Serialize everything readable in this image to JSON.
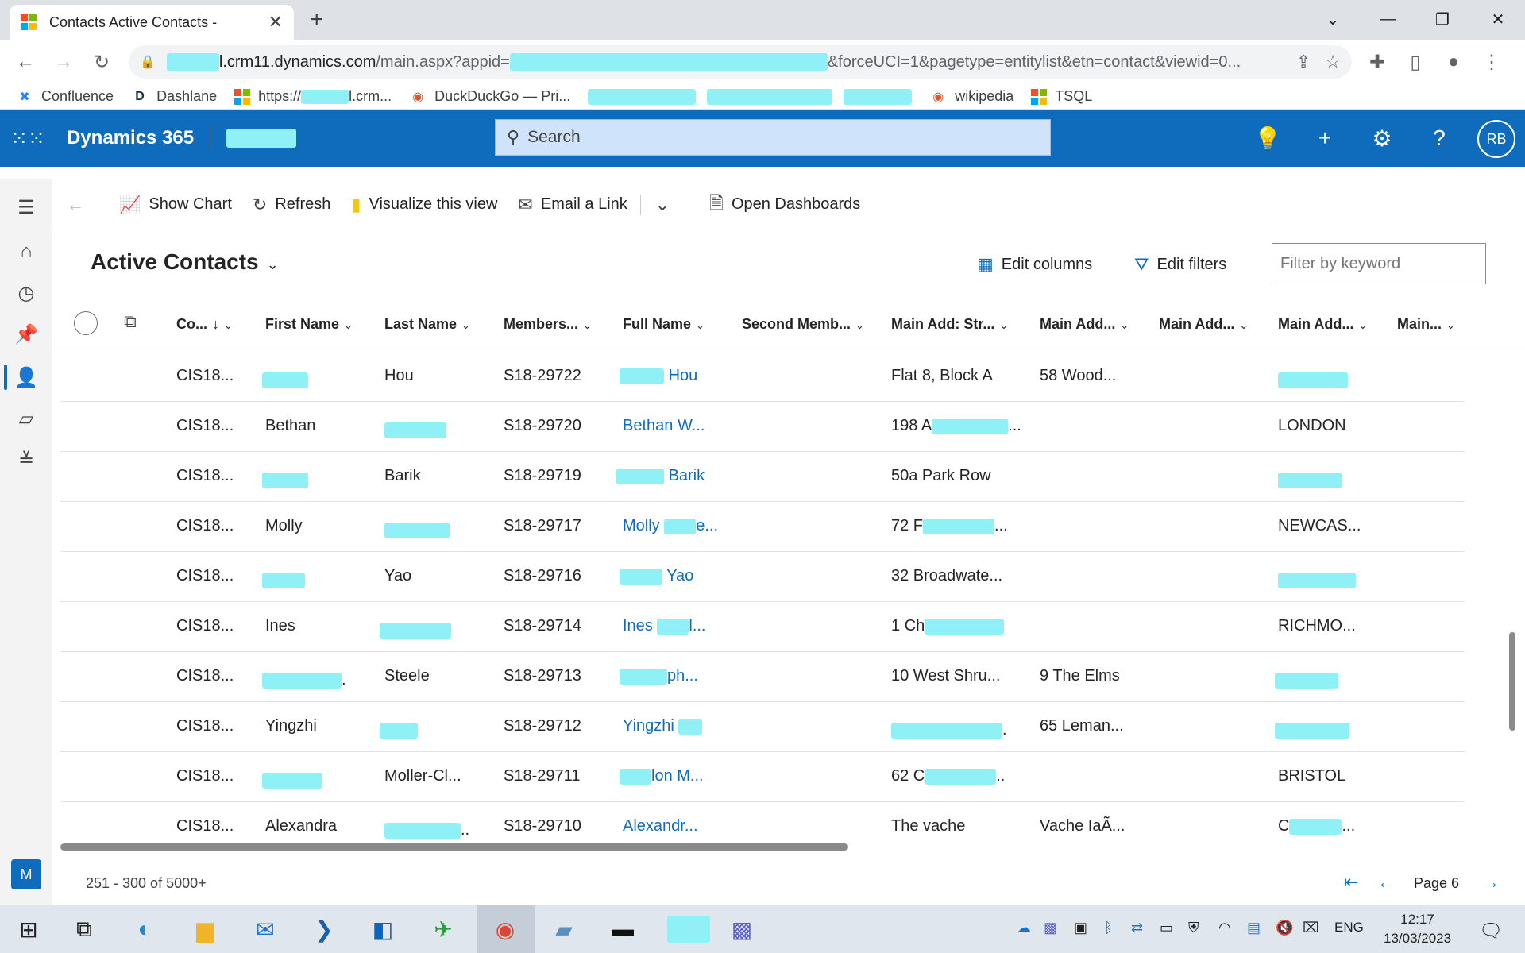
{
  "browser": {
    "tab_title": "Contacts Active Contacts -",
    "url_host_suffix": "l.crm11.dynamics.com",
    "url_path_start": "/main.aspx?appid=",
    "url_path_end": "&forceUCI=1&pagetype=entitylist&etn=contact&viewid=0...",
    "bookmarks": [
      {
        "label": "Confluence",
        "icon": "confluence-icon"
      },
      {
        "label": "Dashlane",
        "icon": "dashlane-icon"
      },
      {
        "label": "https://",
        "suffix": "l.crm...",
        "icon": "microsoft-icon"
      },
      {
        "label": "DuckDuckGo — Pri...",
        "icon": "duckduckgo-icon"
      },
      {
        "label": "wikipedia",
        "icon": "duckduckgo-icon"
      },
      {
        "label": "TSQL",
        "icon": "microsoft-icon"
      }
    ]
  },
  "app": {
    "name": "Dynamics 365",
    "search_placeholder": "Search",
    "avatar_initials": "RB"
  },
  "commands": {
    "show_chart": "Show Chart",
    "refresh": "Refresh",
    "visualize": "Visualize this view",
    "email_link": "Email a Link",
    "open_dashboards": "Open Dashboards"
  },
  "view": {
    "title": "Active Contacts",
    "edit_columns": "Edit columns",
    "edit_filters": "Edit filters",
    "filter_placeholder": "Filter by keyword"
  },
  "grid": {
    "columns": [
      "Co...",
      "First Name",
      "Last Name",
      "Members...",
      "Full Name",
      "Second Memb...",
      "Main Add: Str...",
      "Main Add...",
      "Main Add...",
      "Main Add...",
      "Main..."
    ],
    "rows": [
      {
        "co": "CIS18...",
        "first": "",
        "last": "Hou",
        "member": "S18-29722",
        "full": "Hou",
        "street": "Flat 8, Block A",
        "add2": "58 Wood...",
        "city": ""
      },
      {
        "co": "CIS18...",
        "first": "Bethan",
        "last": "",
        "member": "S18-29720",
        "full": "Bethan W...",
        "street": "198 A",
        "add2": "",
        "city": "LONDON"
      },
      {
        "co": "CIS18...",
        "first": "",
        "last": "Barik",
        "member": "S18-29719",
        "full": "Barik",
        "street": "50a Park Row",
        "add2": "",
        "city": ""
      },
      {
        "co": "CIS18...",
        "first": "Molly",
        "last": "",
        "member": "S18-29717",
        "full": "Molly",
        "street": "72 F",
        "add2": "",
        "city": "NEWCAS..."
      },
      {
        "co": "CIS18...",
        "first": "",
        "last": "Yao",
        "member": "S18-29716",
        "full": "Yao",
        "street": "32 Broadwate...",
        "add2": "",
        "city": ""
      },
      {
        "co": "CIS18...",
        "first": "Ines",
        "last": "",
        "member": "S18-29714",
        "full": "Ines",
        "street": "1 Ch",
        "add2": "",
        "city": "RICHMO..."
      },
      {
        "co": "CIS18...",
        "first": "",
        "last": "Steele",
        "member": "S18-29713",
        "full": "ph...",
        "street": "10 West Shru...",
        "add2": "9 The Elms",
        "city": ""
      },
      {
        "co": "CIS18...",
        "first": "Yingzhi",
        "last": "",
        "member": "S18-29712",
        "full": "Yingzhi",
        "street": "",
        "add2": "65 Leman...",
        "city": ""
      },
      {
        "co": "CIS18...",
        "first": "",
        "last": "Moller-Cl...",
        "member": "S18-29711",
        "full": "lon M...",
        "street": "62 C",
        "add2": "",
        "city": "BRISTOL"
      },
      {
        "co": "CIS18...",
        "first": "Alexandra",
        "last": "",
        "member": "S18-29710",
        "full": "Alexandr...",
        "street": "The vache",
        "add2": "Vache IaÃ...",
        "city": "C"
      }
    ]
  },
  "footer": {
    "count": "251 - 300 of 5000+",
    "page": "Page 6"
  },
  "taskbar": {
    "lang": "ENG",
    "time": "12:17",
    "date": "13/03/2023"
  },
  "colors": {
    "brand": "#0f6cbd",
    "redaction": "#8ff0f5"
  }
}
